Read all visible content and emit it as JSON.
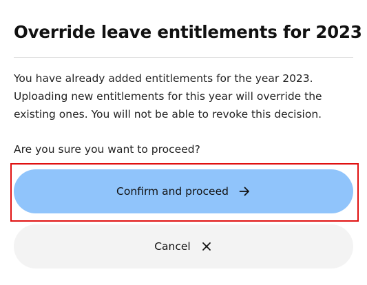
{
  "dialog": {
    "title": "Override leave entitlements for 2023",
    "message": "You have already added entitlements for the year 2023. Uploading new entitlements for this year will override the existing ones. You will not be able to revoke this decision.",
    "question": "Are you sure you want to proceed?",
    "confirm_button": {
      "label": "Confirm and proceed",
      "icon": "arrow-right-icon",
      "color": "#90c4fb"
    },
    "cancel_button": {
      "label": "Cancel",
      "icon": "close-icon",
      "color": "#f3f3f3"
    }
  },
  "colors": {
    "highlight": "#e01010",
    "divider": "#e2e2e2"
  }
}
